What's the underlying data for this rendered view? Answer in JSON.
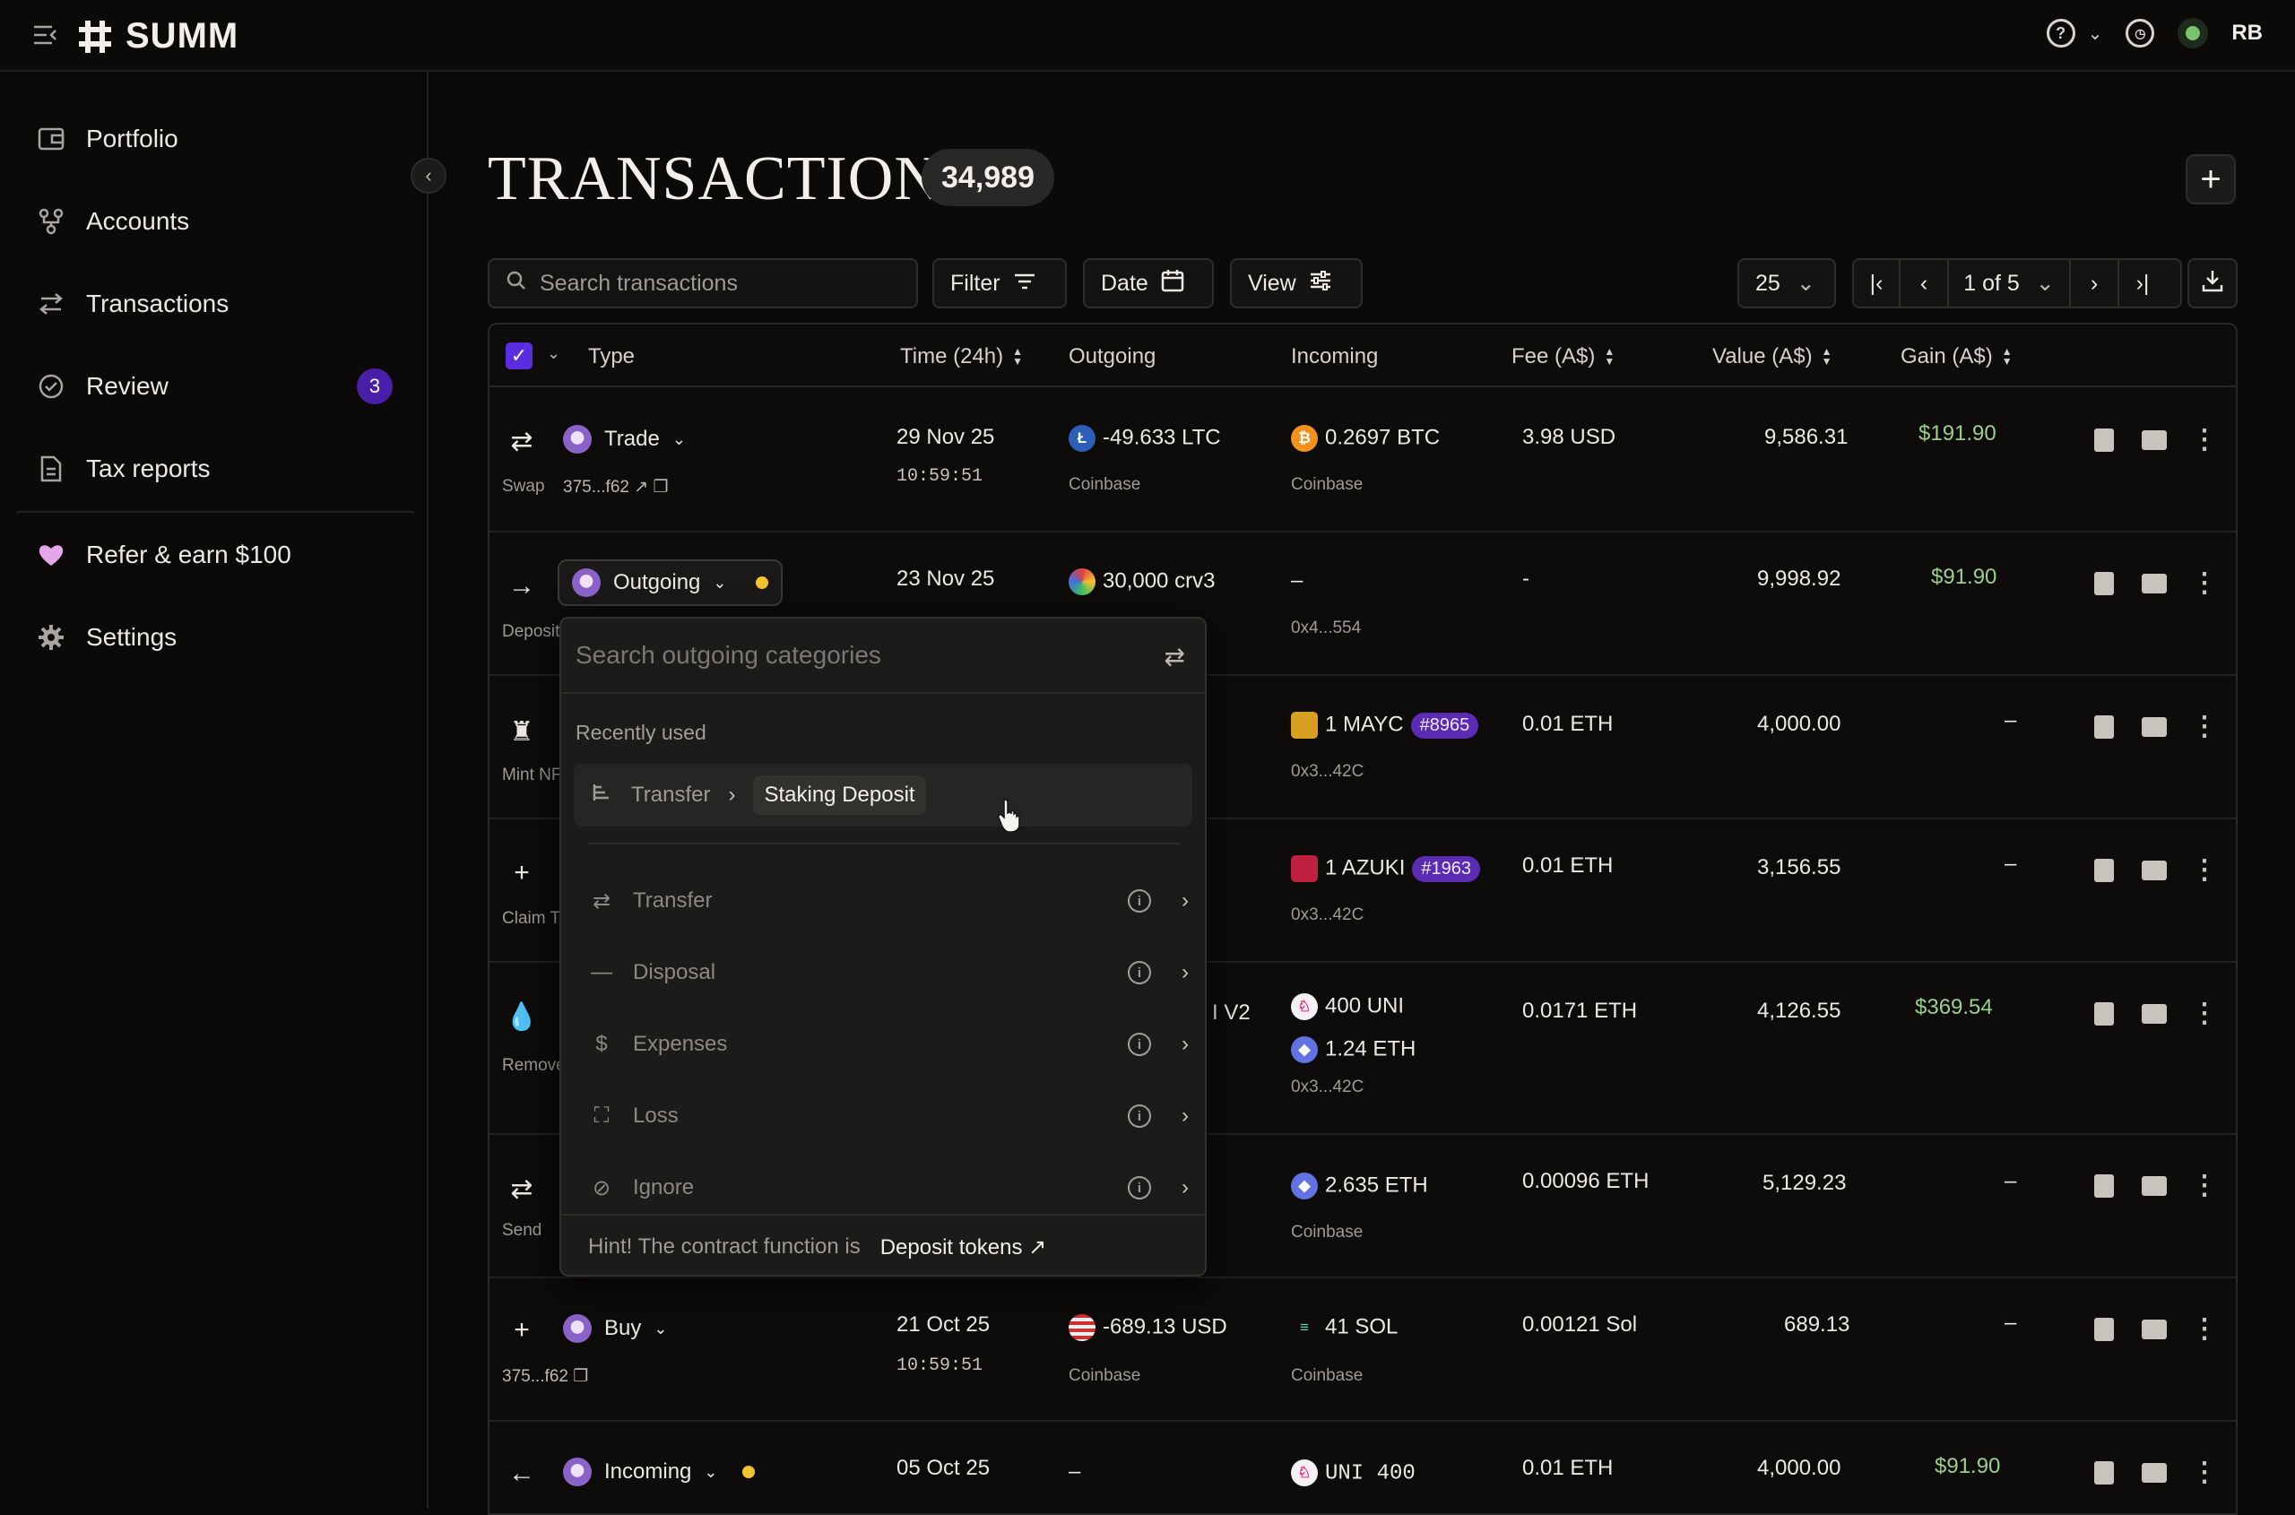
{
  "app": {
    "name": "SUMM",
    "user_initials": "RB"
  },
  "topbar": {
    "help_icon": "help-circle-icon",
    "history_icon": "clock-icon"
  },
  "sidebar": {
    "items": [
      {
        "label": "Portfolio",
        "icon": "wallet-icon"
      },
      {
        "label": "Accounts",
        "icon": "accounts-icon"
      },
      {
        "label": "Transactions",
        "icon": "transfer-icon"
      },
      {
        "label": "Review",
        "icon": "check-circle-icon",
        "badge": "3"
      },
      {
        "label": "Tax reports",
        "icon": "document-icon"
      },
      {
        "label": "Refer & earn $100",
        "icon": "heart-icon"
      },
      {
        "label": "Settings",
        "icon": "gear-icon"
      }
    ]
  },
  "page": {
    "title": "TRANSACTIONS",
    "count": "34,989"
  },
  "toolbar": {
    "search_placeholder": "Search transactions",
    "filter_label": "Filter",
    "date_label": "Date",
    "view_label": "View",
    "page_size": "25",
    "pagination": "1 of 5"
  },
  "table": {
    "headers": {
      "type": "Type",
      "time": "Time (24h)",
      "outgoing": "Outgoing",
      "incoming": "Incoming",
      "fee": "Fee (A$)",
      "value": "Value (A$)",
      "gain": "Gain (A$)"
    },
    "rows": [
      {
        "type": "Trade",
        "sub": "Swap",
        "hash": "375...f62",
        "date": "29 Nov 25",
        "time": "10:59:51",
        "out": "-49.633 LTC",
        "out_src": "Coinbase",
        "in": "0.2697 BTC",
        "in_src": "Coinbase",
        "fee": "3.98 USD",
        "value": "9,586.31",
        "gain": "$191.90"
      },
      {
        "type": "Outgoing",
        "sub": "Deposit",
        "date": "23 Nov 25",
        "out": "30,000 crv3",
        "in": "–",
        "in_src": "0x4...554",
        "fee": "-",
        "value": "9,998.92",
        "gain": "$91.90"
      },
      {
        "sub": "Mint NF",
        "in": "1 MAYC",
        "in_tag": "#8965",
        "in_src": "0x3...42C",
        "fee": "0.01 ETH",
        "value": "4,000.00",
        "gain": "–"
      },
      {
        "sub": "Claim T",
        "in": "1 AZUKI",
        "in_tag": "#1963",
        "in_src": "0x3...42C",
        "fee": "0.01 ETH",
        "value": "3,156.55",
        "gain": "–"
      },
      {
        "sub": "Remove",
        "out_partial": "I V2",
        "in": "400 UNI",
        "in2": "1.24 ETH",
        "in_src": "0x3...42C",
        "fee": "0.0171 ETH",
        "value": "4,126.55",
        "gain": "$369.54"
      },
      {
        "sub": "Send",
        "in": "2.635 ETH",
        "in_src": "Coinbase",
        "fee": "0.00096 ETH",
        "value": "5,129.23",
        "gain": "–"
      },
      {
        "type": "Buy",
        "hash": "375...f62",
        "date": "21 Oct 25",
        "time": "10:59:51",
        "out": "-689.13 USD",
        "out_src": "Coinbase",
        "in": "41 SOL",
        "in_src": "Coinbase",
        "fee": "0.00121 Sol",
        "value": "689.13",
        "gain": "–"
      },
      {
        "type": "Incoming",
        "date": "05 Oct 25",
        "out": "–",
        "in": "UNI 400",
        "fee": "0.01 ETH",
        "value": "4,000.00",
        "gain": "$91.90"
      }
    ]
  },
  "dropdown": {
    "search_placeholder": "Search outgoing categories",
    "recent_label": "Recently used",
    "recent_parent": "Transfer",
    "recent_child": "Staking Deposit",
    "items": [
      "Transfer",
      "Disposal",
      "Expenses",
      "Loss",
      "Ignore"
    ],
    "hint": "Hint! The contract function is",
    "hint_link": "Deposit tokens"
  },
  "colors": {
    "accent": "#5b2de0",
    "badge": "#4a1fa8",
    "gain": "#9ccf8b",
    "dot": "#f2c230"
  }
}
